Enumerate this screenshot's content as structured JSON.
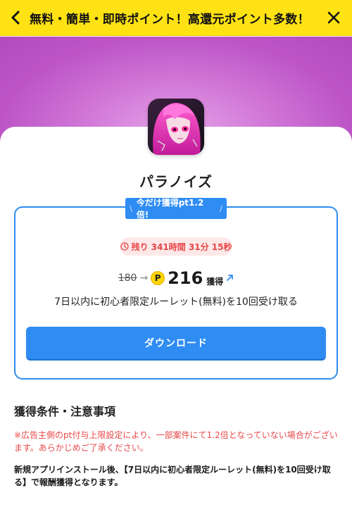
{
  "banner": {
    "title": "無料・簡単・即時ポイント！高還元ポイント多数！",
    "back_icon": "chevron-left-icon",
    "close_icon": "close-icon",
    "background": "#ffe214"
  },
  "app": {
    "name": "パラノイズ",
    "icon": "app-icon-paranoise"
  },
  "offer": {
    "ribbon_text": "今だけ獲得pt1.2倍!",
    "ribbon_left": "\\",
    "ribbon_right": "/",
    "timer_text": "残り 341時間 31分 15秒",
    "old_points": "180",
    "point_symbol": "P",
    "new_points": "216",
    "unit": "獲得",
    "condition": "7日以内に初心者限定ルーレット(無料)を10回受け取る",
    "button_label": "ダウンロード",
    "accent": "#2f8cf3",
    "warning": "#e84747"
  },
  "notes": {
    "title": "獲得条件・注意事項",
    "caution": "※広告主側のpt付与上限設定により、一部案件にて1.2倍となっていない場合がございます。あらかじめご了承ください。",
    "description": "新規アプリインストール後、【7日以内に初心者限定ルーレット(無料)を10回受け取る】で報酬獲得となります。"
  }
}
